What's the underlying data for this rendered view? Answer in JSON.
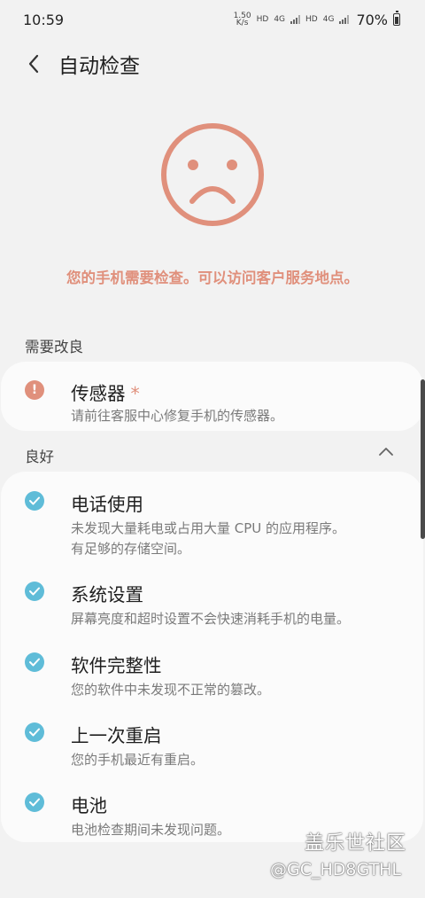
{
  "status_bar": {
    "time": "10:59",
    "net_speed_value": "1.50",
    "net_speed_unit": "K/s",
    "hd1": "HD",
    "net1": "4G",
    "hd2": "HD",
    "net2": "4G",
    "battery": "70%"
  },
  "header": {
    "back_icon": "chevron-left-icon",
    "title": "自动检查"
  },
  "hero": {
    "icon": "sad-face-icon",
    "message": "您的手机需要检查。可以访问客户服务地点。"
  },
  "sections": {
    "needs_improvement": {
      "heading": "需要改良",
      "items": [
        {
          "title": "传感器",
          "marker": "*",
          "description": "请前往客服中心修复手机的传感器。",
          "icon": "alert-icon"
        }
      ]
    },
    "good": {
      "heading": "良好",
      "collapse_icon": "chevron-up-icon",
      "items": [
        {
          "title": "电话使用",
          "description": "未发现大量耗电或占用大量 CPU 的应用程序。",
          "description2": "有足够的存储空间。",
          "icon": "check-icon"
        },
        {
          "title": "系统设置",
          "description": "屏幕亮度和超时设置不会快速消耗手机的电量。",
          "icon": "check-icon"
        },
        {
          "title": "软件完整性",
          "description": "您的软件中未发现不正常的篡改。",
          "icon": "check-icon"
        },
        {
          "title": "上一次重启",
          "description": "您的手机最近有重启。",
          "icon": "check-icon"
        },
        {
          "title": "电池",
          "description": "电池检查期间未发现问题。",
          "icon": "check-icon"
        }
      ]
    }
  },
  "watermark": {
    "logo_text": "盖乐世社区",
    "handle": "@GC_HD8GTHL"
  },
  "colors": {
    "background": "#f2f2f2",
    "card": "#fbfbfb",
    "warning": "#e0907c",
    "ok": "#5fbcd8"
  }
}
